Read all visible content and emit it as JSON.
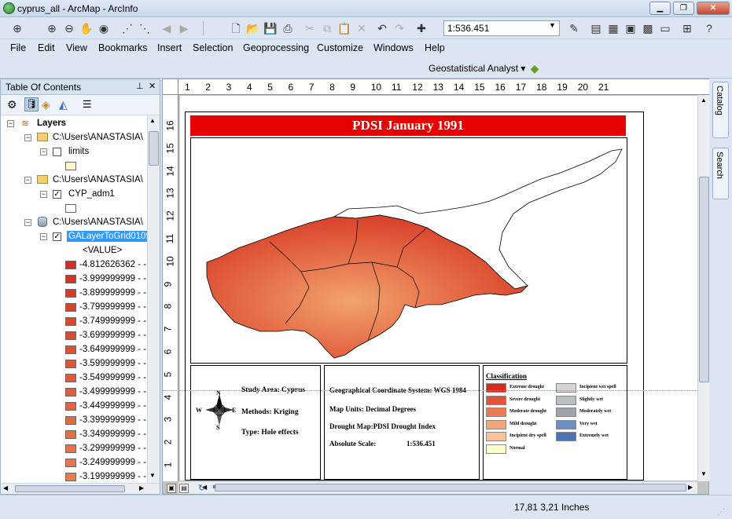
{
  "window": {
    "title": "cyprus_all - ArcMap - ArcInfo"
  },
  "toolbar": {
    "scale": "1:536.451"
  },
  "menu": [
    "File",
    "Edit",
    "View",
    "Bookmarks",
    "Insert",
    "Selection",
    "Geoprocessing",
    "Customize",
    "Windows",
    "Help"
  ],
  "geostat": {
    "label": "Geostatistical Analyst ▾"
  },
  "toc": {
    "title": "Table Of Contents",
    "root": "Layers",
    "rows": [
      {
        "text": "C:\\Users\\ANASTASIA\\"
      },
      {
        "text": "limits"
      },
      {
        "text": "C:\\Users\\ANASTASIA\\"
      },
      {
        "text": "CYP_adm1"
      },
      {
        "text": "C:\\Users\\ANASTASIA\\"
      },
      {
        "text": "GALayerToGrid0109"
      },
      {
        "text": "<VALUE>"
      }
    ],
    "values": [
      {
        "label": "-4.812626362 - -",
        "color": "#d92b1f"
      },
      {
        "label": "-3.999999999 - -",
        "color": "#db3322"
      },
      {
        "label": "-3.899999999 - -",
        "color": "#dc3a26"
      },
      {
        "label": "-3.799999999 - -",
        "color": "#dd4029"
      },
      {
        "label": "-3.749999999 - -",
        "color": "#de452c"
      },
      {
        "label": "-3.699999999 - -",
        "color": "#df4a2f"
      },
      {
        "label": "-3.649999999 - -",
        "color": "#e04f32"
      },
      {
        "label": "-3.599999999 - -",
        "color": "#e15435"
      },
      {
        "label": "-3.549999999 - -",
        "color": "#e25938"
      },
      {
        "label": "-3.499999999 - -",
        "color": "#e35e3b"
      },
      {
        "label": "-3.449999999 - -",
        "color": "#e4633e"
      },
      {
        "label": "-3.399999999 - -",
        "color": "#e56841"
      },
      {
        "label": "-3.349999999 - -",
        "color": "#e66d44"
      },
      {
        "label": "-3.299999999 - -",
        "color": "#e77247"
      },
      {
        "label": "-3.249999999 - -",
        "color": "#e8774a"
      },
      {
        "label": "-3.199999999 - -",
        "color": "#e97c4d"
      }
    ]
  },
  "ruler": {
    "h": [
      "1",
      "2",
      "3",
      "4",
      "5",
      "6",
      "7",
      "8",
      "9",
      "10",
      "11",
      "12",
      "13",
      "14",
      "15",
      "16",
      "17",
      "18",
      "19",
      "20",
      "21"
    ],
    "v": [
      "16",
      "15",
      "14",
      "13",
      "12",
      "11",
      "10",
      "9",
      "8",
      "7",
      "6",
      "5",
      "4",
      "3",
      "2",
      "1"
    ]
  },
  "map": {
    "title": "PDSI January 1991",
    "north": {
      "n": "N",
      "s": "S",
      "e": "E",
      "w": "W"
    },
    "info1": [
      "Study Area: Cyprus",
      "Methods: Kriging",
      "Type: Hole effects"
    ],
    "info2": [
      "Geographical Coordinate System: WGS 1984",
      "Map Units: Decimal Degrees",
      "Drought Map:PDSI Drought Index",
      "Absolute Scale:",
      "1:536.451"
    ],
    "legend": {
      "title": "Classification",
      "left": [
        {
          "label": "Extreme drought",
          "color": "#d82a1e"
        },
        {
          "label": "Severe drought",
          "color": "#e0553a"
        },
        {
          "label": "Moderate drought",
          "color": "#ea7b55"
        },
        {
          "label": "Mild drought",
          "color": "#f3a57c"
        },
        {
          "label": "Incipient dry spell",
          "color": "#f8c09b"
        },
        {
          "label": "Normal",
          "color": "#fdfdc8"
        }
      ],
      "right": [
        {
          "label": "Incipient wet spell",
          "color": "#d3d5d6"
        },
        {
          "label": "Slightly wet",
          "color": "#b6bfc5"
        },
        {
          "label": "Moderately wet",
          "color": "#9fa4ab"
        },
        {
          "label": "Very wet",
          "color": "#6c8fc2"
        },
        {
          "label": "Extremely wet",
          "color": "#4d74b4"
        }
      ]
    }
  },
  "dock": {
    "catalog": "Catalog",
    "search": "Search"
  },
  "status": {
    "coords": "17,81  3,21 Inches"
  }
}
